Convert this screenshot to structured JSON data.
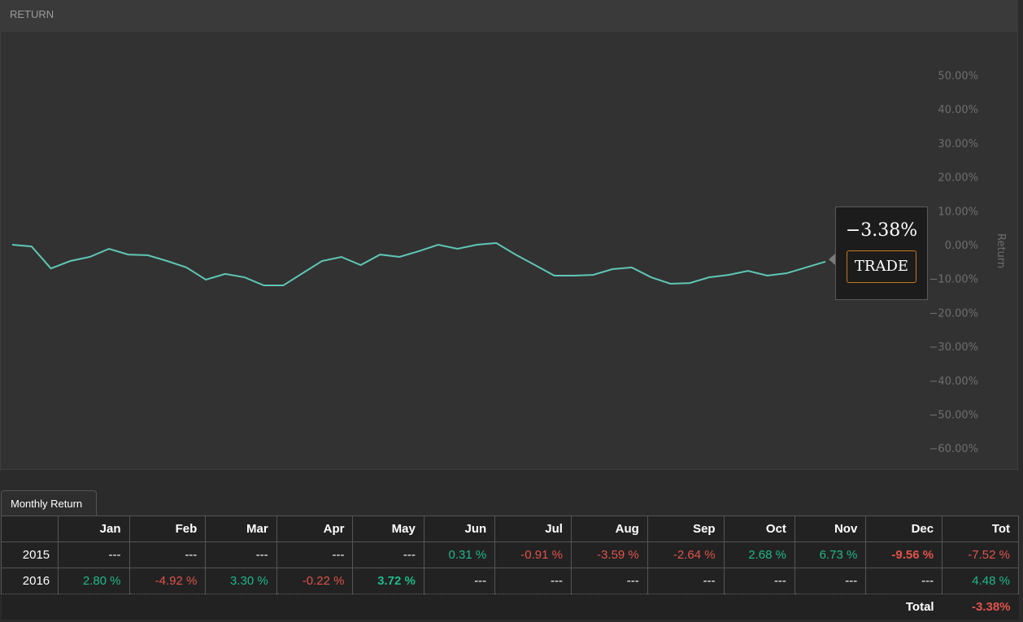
{
  "header": {
    "title": "RETURN"
  },
  "colors": {
    "line": "#5fc7b4",
    "positive": "#1fb98a",
    "negative": "#e0534b",
    "trade_border": "#c8781e"
  },
  "chart_data": {
    "type": "line",
    "ylabel": "Return",
    "ylim": [
      -60,
      50
    ],
    "yticks": [
      "50.00%",
      "40.00%",
      "30.00%",
      "20.00%",
      "10.00%",
      "0.00%",
      "−10.00%",
      "−20.00%",
      "−30.00%",
      "−40.00%",
      "−50.00%",
      "−60.00%"
    ],
    "grid": false,
    "series": [
      {
        "values": [
          0,
          -0.5,
          -7,
          -4.8,
          -3.6,
          -1.2,
          -2.9,
          -3.1,
          -4.8,
          -6.7,
          -10.3,
          -8.6,
          -9.6,
          -12,
          -12,
          -8.4,
          -4.8,
          -3.6,
          -6,
          -2.9,
          -3.6,
          -1.9,
          0,
          -1.2,
          0,
          0.5,
          -2.9,
          -6,
          -9.1,
          -9.1,
          -8.9,
          -7.2,
          -6.7,
          -9.6,
          -11.5,
          -11.3,
          -9.6,
          -8.9,
          -7.7,
          -9.1,
          -8.4,
          -6.7,
          -5.0
        ]
      }
    ]
  },
  "tooltip": {
    "value": "−3.38%",
    "button": "TRADE"
  },
  "monthly": {
    "tab": "Monthly Return",
    "headers": [
      "",
      "Jan",
      "Feb",
      "Mar",
      "Apr",
      "May",
      "Jun",
      "Jul",
      "Aug",
      "Sep",
      "Oct",
      "Nov",
      "Dec",
      "Tot"
    ],
    "rows": [
      {
        "year": "2015",
        "cells": [
          "---",
          "---",
          "---",
          "---",
          "---",
          "0.31 %",
          "-0.91 %",
          "-3.59 %",
          "-2.64 %",
          "2.68 %",
          "6.73 %",
          "-9.56 %",
          "-7.52 %"
        ]
      },
      {
        "year": "2016",
        "cells": [
          "2.80 %",
          "-4.92 %",
          "3.30 %",
          "-0.22 %",
          "3.72 %",
          "---",
          "---",
          "---",
          "---",
          "---",
          "---",
          "---",
          "4.48 %"
        ]
      }
    ],
    "bold": {
      "2015": [
        11
      ],
      "2016": [
        4
      ]
    },
    "total_label": "Total",
    "total_value": "-3.38%"
  }
}
